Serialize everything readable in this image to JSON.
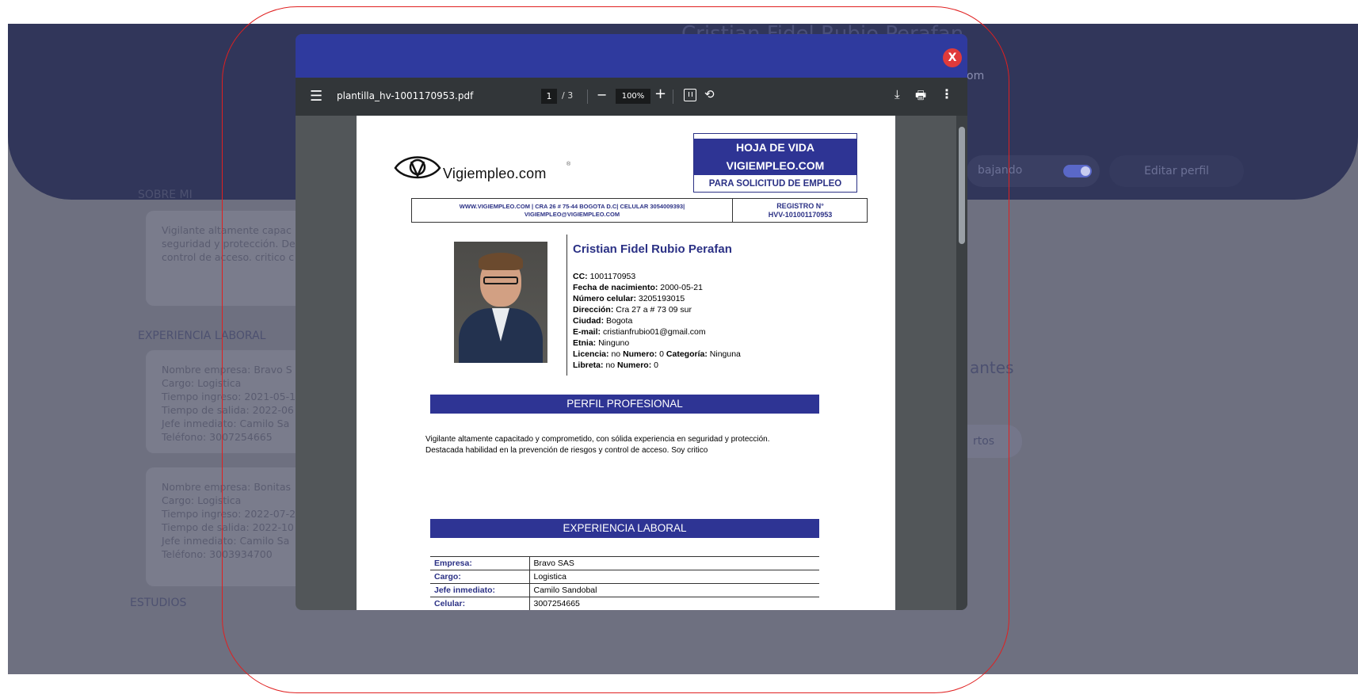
{
  "background": {
    "profile_name": "Cristian Fidel Rubio Perafan",
    "email_fragment": "om",
    "toggle_label": "bajando",
    "edit_button": "Editar perfil",
    "section_about": "SOBRE MI",
    "about_text": [
      "Vigilante altamente capac",
      "seguridad y protección. De",
      "control de acceso. critico c"
    ],
    "section_experience": "EXPERIENCIA LABORAL",
    "exp_cards": [
      [
        "Nombre empresa: Bravo S",
        "Cargo: Logistica",
        "Tiempo ingreso: 2021-05-1",
        "Tiempo de salida: 2022-06",
        "Jefe inmediato: Camilo Sa",
        "Teléfono: 3007254665"
      ],
      [
        "Nombre empresa: Bonitas",
        "Cargo: Logistica",
        "Tiempo ingreso: 2022-07-2",
        "Tiempo de salida: 2022-10",
        "Jefe inmediato: Camilo Sa",
        "Teléfono: 3003934700"
      ]
    ],
    "section_studies": "ESTUDIOS",
    "right_text_fragment": "antes",
    "right_button_fragment": "rtos"
  },
  "modal": {
    "close_label": "X",
    "colors": {
      "header": "#2f3a9e",
      "close": "#e03a3a"
    }
  },
  "toolbar": {
    "filename": "plantilla_hv-1001170953.pdf",
    "page_current": "1",
    "page_total": "/ 3",
    "zoom_out": "−",
    "zoom": "100%",
    "zoom_in": "+",
    "menu_icon": "☰",
    "rotate_icon": "⟲",
    "download_icon": "⤓",
    "print_icon": "🖶",
    "more_icon": "⋮"
  },
  "document": {
    "logo_text": "Vigiempleo.com",
    "logo_reg": "®",
    "hv_title_1": "HOJA DE VIDA",
    "hv_title_2": "VIGIEMPLEO.COM",
    "hv_subtitle": "PARA SOLICITUD DE EMPLEO",
    "info_line_1": "WWW.VIGIEMPLEO.COM | CRA 26 # 75-44 BOGOTA D.C| CELULAR 3054009393|",
    "info_line_2": "VIGIEMPLEO@VIGIEMPLEO.COM",
    "registro_label": "REGISTRO N°",
    "registro_value": "HVV-101001170953",
    "person_name": "Cristian Fidel Rubio Perafan",
    "cc_label": "CC:",
    "cc_value": "1001170953",
    "birth_label": "Fecha de nacimiento:",
    "birth_value": "2000-05-21",
    "phone_label": "Número celular:",
    "phone_value": "3205193015",
    "address_label": "Dirección:",
    "address_value": "Cra 27 a # 73 09 sur",
    "city_label": "Ciudad:",
    "city_value": "Bogota",
    "email_label": "E-mail:",
    "email_value": "cristianfrubio01@gmail.com",
    "ethnic_label": "Etnia:",
    "ethnic_value": "Ninguno",
    "license_label": "Licencia:",
    "license_value": "no",
    "license_number_label": "Numero:",
    "license_number_value": "0",
    "category_label": "Categoría:",
    "category_value": "Ninguna",
    "booklet_label": "Libreta:",
    "booklet_value": "no",
    "booklet_number_label": "Numero:",
    "booklet_number_value": "0",
    "section_profile": "PERFIL PROFESIONAL",
    "profile_text_1": "Vigilante altamente capacitado y comprometido, con sólida experiencia en seguridad y protección.",
    "profile_text_2": "Destacada habilidad en la prevención de riesgos y control de acceso. Soy critico",
    "section_experience": "EXPERIENCIA LABORAL",
    "experience_rows": [
      {
        "k": "Empresa:",
        "v": "Bravo SAS"
      },
      {
        "k": "Cargo:",
        "v": "Logistica"
      },
      {
        "k": "Jefe inmediato:",
        "v": "Camilo Sandobal"
      },
      {
        "k": "Celular:",
        "v": "3007254665"
      }
    ]
  }
}
